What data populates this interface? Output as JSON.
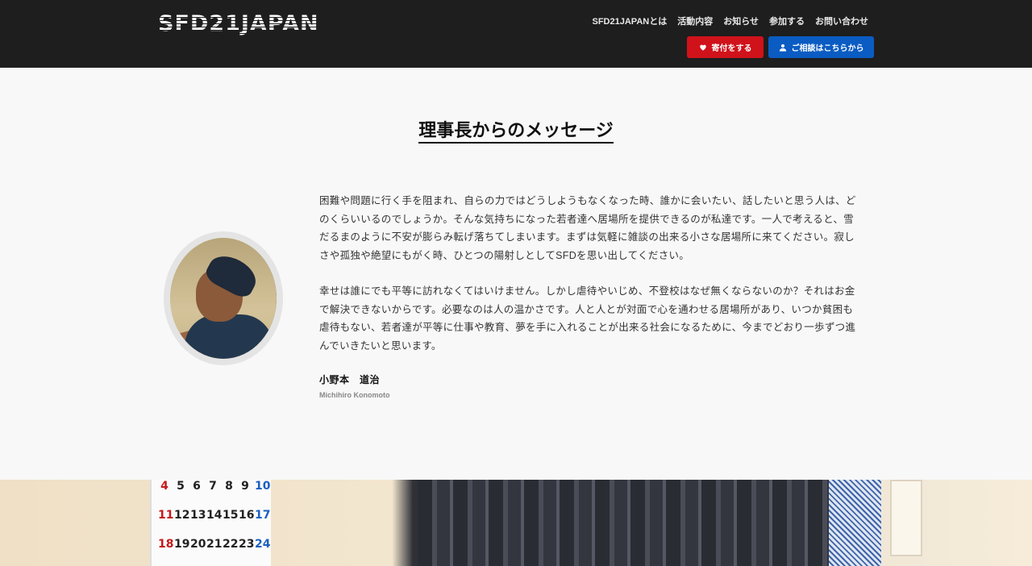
{
  "header": {
    "logo": "SFD21JAPAN",
    "nav": [
      "SFD21JAPANとは",
      "活動内容",
      "お知らせ",
      "参加する",
      "お問い合わせ"
    ],
    "donate_label": "寄付をする",
    "contact_label": "ご相談はこちらから"
  },
  "section": {
    "title": "理事長からのメッセージ",
    "paragraphs": [
      "困難や問題に行く手を阻まれ、自らの力ではどうしようもなくなった時、誰かに会いたい、話したいと思う人は、どのくらいいるのでしょうか。そんな気持ちになった若者達へ居場所を提供できるのが私達です。一人で考えると、雪だるまのように不安が膨らみ転げ落ちてしまいます。まずは気軽に雑談の出来る小さな居場所に来てください。寂しさや孤独や絶望にもがく時、ひとつの陽射しとしてSFDを思い出してください。",
      "幸せは誰にでも平等に訪れなくてはいけません。しかし虐待やいじめ、不登校はなぜ無くならないのか？それはお金で解決できないからです。必要なのは人の温かさです。人と人とが対面で心を通わせる居場所があり、いつか貧困も虐待もない、若者達が平等に仕事や教育、夢を手に入れることが出来る社会になるために、今までどおり一歩ずつ進んでいきたいと思います。"
    ],
    "signature_name": "小野本　道治",
    "signature_en": "Michihiro Konomoto"
  },
  "photo": {
    "calendar_rows": [
      [
        "4",
        "5",
        "6",
        "7",
        "8",
        "9",
        "10"
      ],
      [
        "11",
        "12",
        "13",
        "14",
        "15",
        "16",
        "17"
      ],
      [
        "18",
        "19",
        "20",
        "21",
        "22",
        "23",
        "24"
      ]
    ]
  },
  "colors": {
    "header_bg": "#1e1e1e",
    "donate": "#d0121b",
    "contact": "#0a5cc2"
  }
}
